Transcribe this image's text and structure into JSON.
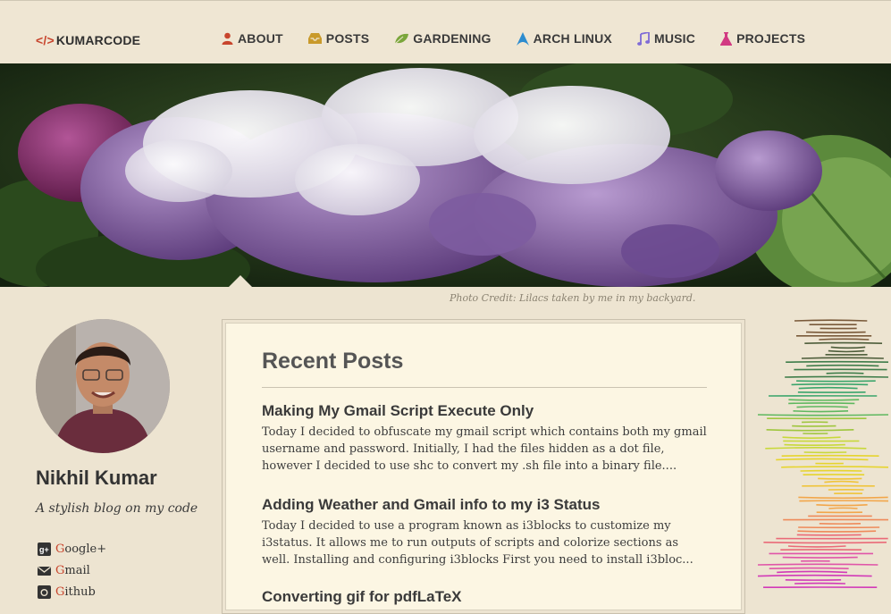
{
  "header": {
    "logo_symbol": "</>",
    "logo_text": "KUMARCODE",
    "nav": [
      {
        "label": "ABOUT",
        "icon": "user-icon",
        "color": "#c8452d"
      },
      {
        "label": "POSTS",
        "icon": "inbox-icon",
        "color": "#c99a2b"
      },
      {
        "label": "GARDENING",
        "icon": "leaf-icon",
        "color": "#7aa63b"
      },
      {
        "label": "ARCH LINUX",
        "icon": "arch-icon",
        "color": "#2c8ccf"
      },
      {
        "label": "MUSIC",
        "icon": "music-icon",
        "color": "#7f6bd6"
      },
      {
        "label": "PROJECTS",
        "icon": "flask-icon",
        "color": "#d23a82"
      }
    ]
  },
  "hero": {
    "photo_credit": "Photo Credit: Lilacs taken by me in my backyard."
  },
  "sidebar": {
    "name": "Nikhil Kumar",
    "tagline": "A stylish blog on my code",
    "social": [
      {
        "first": "G",
        "rest": "oogle+",
        "icon": "google-plus-icon"
      },
      {
        "first": "G",
        "rest": "mail",
        "icon": "mail-icon"
      },
      {
        "first": "G",
        "rest": "ithub",
        "icon": "github-icon"
      }
    ]
  },
  "main": {
    "section_title": "Recent Posts",
    "posts": [
      {
        "title": "Making My Gmail Script Execute Only",
        "excerpt": "Today I decided to obfuscate my gmail script which contains both my gmail username and password. Initially, I had the files hidden as a dot file, however I decided to use shc to convert my .sh file into a binary file...."
      },
      {
        "title": "Adding Weather and Gmail info to my i3 Status",
        "excerpt": "Today I decided to use a program known as i3blocks to customize my i3status. It allows me to run outputs of scripts and colorize sections as well. Installing and configuring i3blocks First you need to install i3bloc..."
      },
      {
        "title": "Converting gif for pdfLaTeX",
        "excerpt": ""
      }
    ]
  },
  "colors": {
    "background": "#ede4d1",
    "card": "#fcf6e3",
    "accent": "#c8452d"
  }
}
